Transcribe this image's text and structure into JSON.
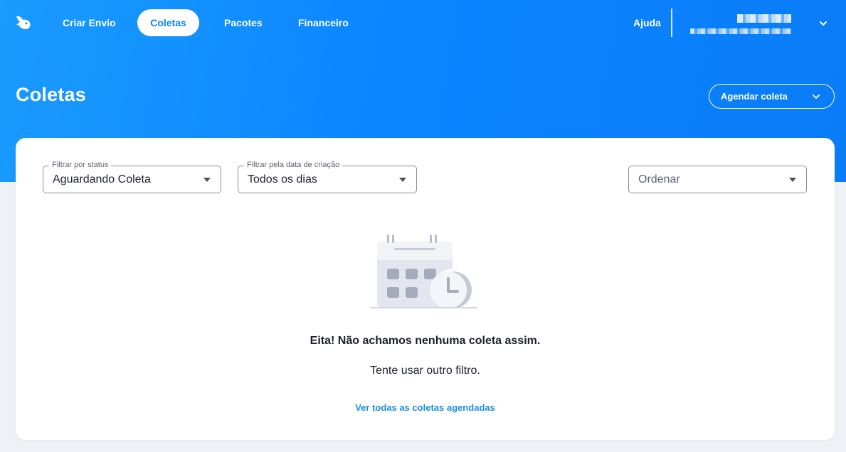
{
  "nav": {
    "items": [
      {
        "label": "Criar Envio",
        "active": false
      },
      {
        "label": "Coletas",
        "active": true
      },
      {
        "label": "Pacotes",
        "active": false
      },
      {
        "label": "Financeiro",
        "active": false
      }
    ],
    "help_label": "Ajuda",
    "logo_icon": "rabbit-logo-icon",
    "user_menu_icon": "chevron-down-icon"
  },
  "header": {
    "title": "Coletas",
    "schedule_button": "Agendar coleta"
  },
  "filters": {
    "status": {
      "legend": "Filtrar por status",
      "value": "Aguardando Coleta"
    },
    "date": {
      "legend": "Filtrar pela data de criação",
      "value": "Todos os dias"
    },
    "sort": {
      "placeholder": "Ordenar"
    }
  },
  "empty_state": {
    "icon": "calendar-clock-icon",
    "title": "Eita! Não achamos nenhuma coleta assim.",
    "subtitle": "Tente usar outro filtro.",
    "link": "Ver todas as coletas agendadas"
  },
  "colors": {
    "primary": "#0a84ff",
    "link": "#1b8fe0",
    "page_background": "#eef1f5"
  }
}
